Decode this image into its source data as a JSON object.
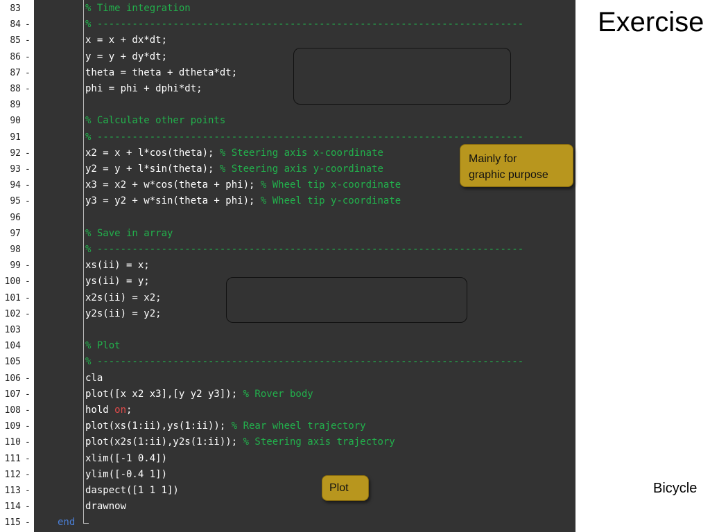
{
  "slide": {
    "title": "Exercise",
    "footer": "Bicycle"
  },
  "callouts": {
    "mainly": "Mainly for\ngraphic purpose",
    "plot": "Plot"
  },
  "editor": {
    "lines": [
      {
        "num": "83",
        "dash": "",
        "segs": [
          {
            "t": "% Time integration",
            "c": "cm"
          }
        ]
      },
      {
        "num": "84",
        "dash": "-",
        "segs": [
          {
            "t": "% -------------------------------------------------------------------------",
            "c": "cm"
          }
        ]
      },
      {
        "num": "85",
        "dash": "-",
        "segs": [
          {
            "t": "x = x + dx*dt;",
            "c": ""
          }
        ]
      },
      {
        "num": "86",
        "dash": "-",
        "segs": [
          {
            "t": "y = y + dy*dt;",
            "c": ""
          }
        ]
      },
      {
        "num": "87",
        "dash": "-",
        "segs": [
          {
            "t": "theta = theta + dtheta*dt;",
            "c": ""
          }
        ]
      },
      {
        "num": "88",
        "dash": "-",
        "segs": [
          {
            "t": "phi = phi + dphi*dt;",
            "c": ""
          }
        ]
      },
      {
        "num": "89",
        "dash": "",
        "segs": []
      },
      {
        "num": "90",
        "dash": "",
        "segs": [
          {
            "t": "% Calculate other points",
            "c": "cm"
          }
        ]
      },
      {
        "num": "91",
        "dash": "",
        "segs": [
          {
            "t": "% -------------------------------------------------------------------------",
            "c": "cm"
          }
        ]
      },
      {
        "num": "92",
        "dash": "-",
        "segs": [
          {
            "t": "x2 = x + l*cos(theta); ",
            "c": ""
          },
          {
            "t": "% Steering axis x-coordinate",
            "c": "cm"
          }
        ]
      },
      {
        "num": "93",
        "dash": "-",
        "segs": [
          {
            "t": "y2 = y + l*sin(theta); ",
            "c": ""
          },
          {
            "t": "% Steering axis y-coordinate",
            "c": "cm"
          }
        ]
      },
      {
        "num": "94",
        "dash": "-",
        "segs": [
          {
            "t": "x3 = x2 + w*cos(theta + phi); ",
            "c": ""
          },
          {
            "t": "% Wheel tip x-coordinate",
            "c": "cm"
          }
        ]
      },
      {
        "num": "95",
        "dash": "-",
        "segs": [
          {
            "t": "y3 = y2 + w*sin(theta + phi); ",
            "c": ""
          },
          {
            "t": "% Wheel tip y-coordinate",
            "c": "cm"
          }
        ]
      },
      {
        "num": "96",
        "dash": "",
        "segs": []
      },
      {
        "num": "97",
        "dash": "",
        "segs": [
          {
            "t": "% Save in array",
            "c": "cm"
          }
        ]
      },
      {
        "num": "98",
        "dash": "",
        "segs": [
          {
            "t": "% -------------------------------------------------------------------------",
            "c": "cm"
          }
        ]
      },
      {
        "num": "99",
        "dash": "-",
        "segs": [
          {
            "t": "xs(ii) = x;",
            "c": ""
          }
        ]
      },
      {
        "num": "100",
        "dash": "-",
        "segs": [
          {
            "t": "ys(ii) = y;",
            "c": ""
          }
        ]
      },
      {
        "num": "101",
        "dash": "-",
        "segs": [
          {
            "t": "x2s(ii) = x2;",
            "c": ""
          }
        ]
      },
      {
        "num": "102",
        "dash": "-",
        "segs": [
          {
            "t": "y2s(ii) = y2;",
            "c": ""
          }
        ]
      },
      {
        "num": "103",
        "dash": "",
        "segs": []
      },
      {
        "num": "104",
        "dash": "",
        "segs": [
          {
            "t": "% Plot",
            "c": "cm"
          }
        ]
      },
      {
        "num": "105",
        "dash": "",
        "segs": [
          {
            "t": "% -------------------------------------------------------------------------",
            "c": "cm"
          }
        ]
      },
      {
        "num": "106",
        "dash": "-",
        "segs": [
          {
            "t": "cla",
            "c": ""
          }
        ]
      },
      {
        "num": "107",
        "dash": "-",
        "segs": [
          {
            "t": "plot([x x2 x3],[y y2 y3]); ",
            "c": ""
          },
          {
            "t": "% Rover body",
            "c": "cm"
          }
        ]
      },
      {
        "num": "108",
        "dash": "-",
        "segs": [
          {
            "t": "hold ",
            "c": ""
          },
          {
            "t": "on",
            "c": "kw"
          },
          {
            "t": ";",
            "c": ""
          }
        ]
      },
      {
        "num": "109",
        "dash": "-",
        "segs": [
          {
            "t": "plot(xs(1:ii),ys(1:ii)); ",
            "c": ""
          },
          {
            "t": "% Rear wheel trajectory",
            "c": "cm"
          }
        ]
      },
      {
        "num": "110",
        "dash": "-",
        "segs": [
          {
            "t": "plot(x2s(1:ii),y2s(1:ii)); ",
            "c": ""
          },
          {
            "t": "% Steering axis trajectory",
            "c": "cm"
          }
        ]
      },
      {
        "num": "111",
        "dash": "-",
        "segs": [
          {
            "t": "xlim([-1 0.4])",
            "c": ""
          }
        ]
      },
      {
        "num": "112",
        "dash": "-",
        "segs": [
          {
            "t": "ylim([-0.4 1])",
            "c": ""
          }
        ]
      },
      {
        "num": "113",
        "dash": "-",
        "segs": [
          {
            "t": "daspect([1 1 1])",
            "c": ""
          }
        ]
      },
      {
        "num": "114",
        "dash": "-",
        "segs": [
          {
            "t": "drawnow",
            "c": ""
          }
        ]
      },
      {
        "num": "115",
        "dash": "-",
        "segs": [
          {
            "t": "end",
            "c": "end"
          }
        ]
      }
    ]
  }
}
